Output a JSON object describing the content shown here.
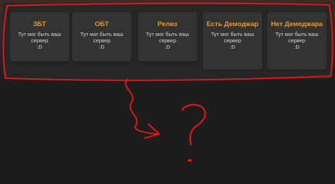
{
  "cards": [
    {
      "title": "ЗБТ",
      "text": "Тут мог быть ваш сервер",
      "face": ":D"
    },
    {
      "title": "ОБТ",
      "text": "Тут мог быть ваш сервер",
      "face": ":D"
    },
    {
      "title": "Релиз",
      "text": "Тут мог быть ваш сервер",
      "face": ":D"
    },
    {
      "title": "Есть Демоджар",
      "text": "Тут мог быть ваш сервер",
      "face": ":D"
    },
    {
      "title": "Нет Демоджара",
      "text": "Тут мог быть ваш сервер",
      "face": ":D"
    }
  ],
  "colors": {
    "accent": "#e49a2a",
    "annotation": "#e01818",
    "panel": "#262626",
    "card": "#333333"
  }
}
